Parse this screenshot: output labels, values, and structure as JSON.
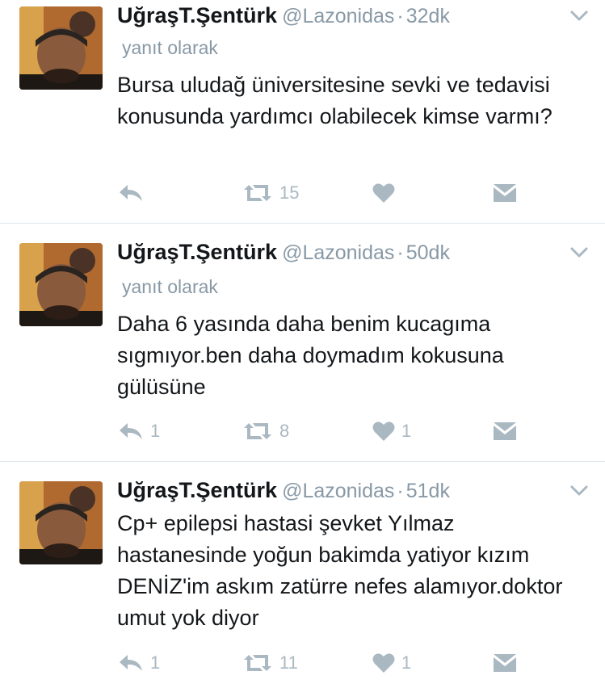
{
  "colors": {
    "icon": "#aab8c2",
    "muted": "#8899a6",
    "text": "#14171a",
    "divider": "#e1e8ed"
  },
  "tweets": [
    {
      "name": "UğraşT.Şentürk",
      "handle": "@Lazonidas",
      "separator": "·",
      "time": "32dk",
      "replying": "yanıt olarak",
      "text": "Bursa uludağ üniversitesine sevki ve tedavisi konusunda yardımcı olabilecek kimse varmı?",
      "reply_count": "",
      "retweet_count": "15",
      "like_count": ""
    },
    {
      "name": "UğraşT.Şentürk",
      "handle": "@Lazonidas",
      "separator": "·",
      "time": "50dk",
      "replying": "yanıt olarak",
      "text": "Daha 6 yasında daha benim kucagıma sıgmıyor.ben daha doymadım kokusuna gülüsüne",
      "reply_count": "1",
      "retweet_count": "8",
      "like_count": "1"
    },
    {
      "name": "UğraşT.Şentürk",
      "handle": "@Lazonidas",
      "separator": "·",
      "time": "51dk",
      "text": "Cp+ epilepsi hastasi şevket Yılmaz hastanesinde yoğun bakimda yatiyor kızım DENİZ'im askım zatürre nefes alamıyor.doktor umut yok diyor",
      "reply_count": "1",
      "retweet_count": "11",
      "like_count": "1"
    }
  ]
}
